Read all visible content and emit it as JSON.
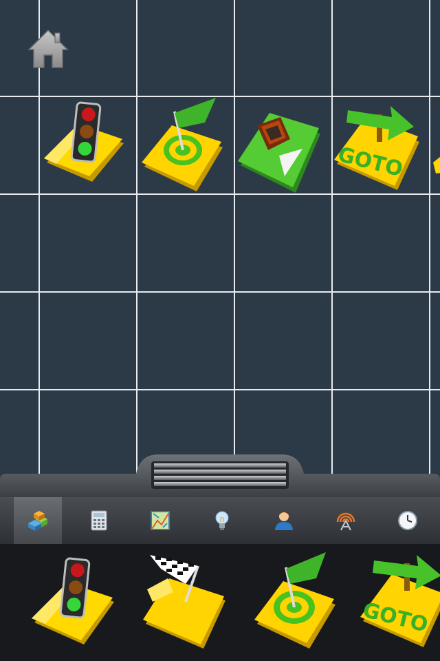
{
  "canvas": {
    "blocks": [
      {
        "type": "traffic-light"
      },
      {
        "type": "flag-target"
      },
      {
        "type": "robot-move"
      },
      {
        "type": "goto",
        "label": "GOTO"
      }
    ]
  },
  "toolbar": {
    "tabs": [
      {
        "icon": "blocks-icon",
        "active": true
      },
      {
        "icon": "calculator-icon",
        "active": false
      },
      {
        "icon": "map-icon",
        "active": false
      },
      {
        "icon": "lightbulb-icon",
        "active": false
      },
      {
        "icon": "user-icon",
        "active": false
      },
      {
        "icon": "antenna-icon",
        "active": false
      },
      {
        "icon": "clock-icon",
        "active": false
      }
    ]
  },
  "palette": {
    "blocks": [
      {
        "type": "traffic-light"
      },
      {
        "type": "checkered-flag"
      },
      {
        "type": "flag-target"
      },
      {
        "type": "goto",
        "label": "GOTO"
      }
    ]
  },
  "colors": {
    "canvas_bg": "#2c3a48",
    "grid_line": "#e8ecef",
    "tile_yellow": "#ffd400",
    "tile_green": "#4fcb32",
    "palette_bg": "#17191c"
  }
}
